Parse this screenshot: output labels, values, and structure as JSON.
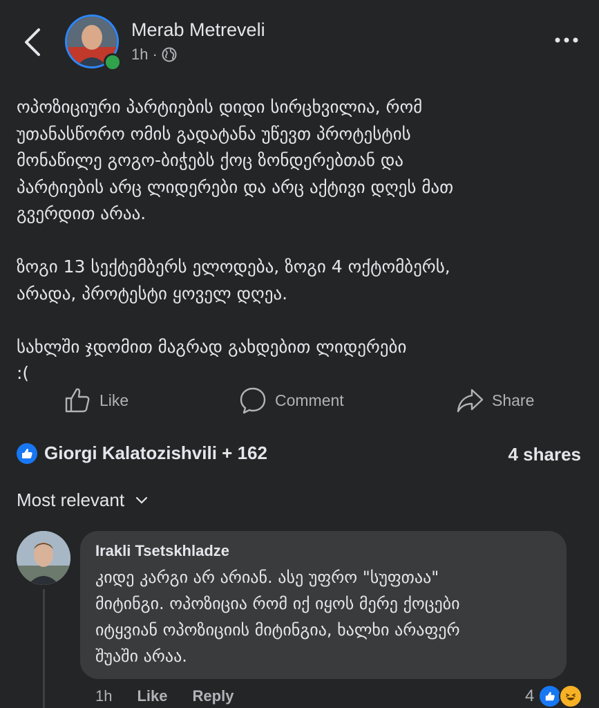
{
  "header": {
    "author_name": "Merab Metreveli",
    "time": "1h",
    "separator": "·",
    "privacy_icon": "globe-icon"
  },
  "post": {
    "text": "ოპოზიციური პარტიების დიდი სირცხვილია, რომ\nუთანასწორო ომის გადატანა უწევთ პროტესტის\nმონაწილე გოგო-ბიჭებს ქოც ზონდერებთან და\nპარტიების არც ლიდერები და არც აქტივი დღეს მათ\nგვერდით არაა.\n\nზოგი 13 სექტემბერს ელოდება, ზოგი 4 ოქტომბერს,\nარადა, პროტესტი ყოველ დღეა.\n\nსახლში ჯდომით მაგრად გახდებით ლიდერები\n:("
  },
  "actions": {
    "like": "Like",
    "comment": "Comment",
    "share": "Share"
  },
  "reactions": {
    "summary": "Giorgi Kalatozishvili + 162",
    "shares": "4 shares"
  },
  "comments_sort": {
    "label": "Most relevant"
  },
  "comment": {
    "author": "Irakli Tsetskhladze",
    "text": "კიდე კარგი არ არიან. ასე უფრო \"სუფთაა\"\nმიტინგი. ოპოზიცია რომ იქ იყოს მერე ქოცები\nიტყვიან ოპოზიციის მიტინგია, ხალხი არაფერ\nშუაში არაა.",
    "time": "1h",
    "like": "Like",
    "reply": "Reply",
    "reaction_count": "4"
  },
  "colors": {
    "background": "#242526",
    "bubble": "#3a3b3c",
    "accent": "#1877f2",
    "online": "#31a24c"
  }
}
